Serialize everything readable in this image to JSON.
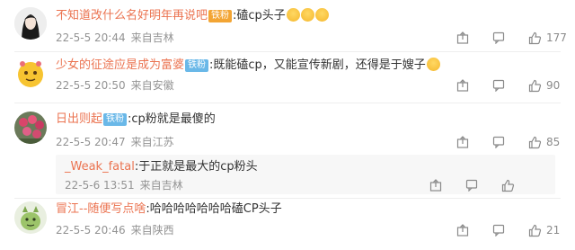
{
  "comments": [
    {
      "user": "不知道改什么名好明年再说吧",
      "badge": "铁粉",
      "colon": ":",
      "text": "磕cp头子",
      "time": "22-5-5 20:44",
      "location": "来自吉林",
      "likes": "177",
      "avatar": "girl-portrait"
    },
    {
      "user": "少女的征途应是成为富婆",
      "badge": "铁粉",
      "colon": ":",
      "text": "既能磕cp，又能宣传新剧，还得是于嫂子",
      "time": "22-5-5 20:50",
      "location": "来自安徽",
      "likes": "90",
      "avatar": "emoji-face"
    },
    {
      "user": "日出则起",
      "badge": "铁粉",
      "colon": ":",
      "text": "cp粉就是最傻的",
      "time": "22-5-5 20:47",
      "location": "来自江苏",
      "likes": "85",
      "avatar": "flowers",
      "reply": {
        "user": "_Weak_fatal",
        "colon": ":",
        "text": "于正就是最大的cp粉头",
        "time": "22-5-6 13:51",
        "location": "来自吉林"
      }
    },
    {
      "user": "冒江--随便写点啥",
      "colon": ":",
      "text": "哈哈哈哈哈哈哈磕CP头子",
      "time": "22-5-5 20:46",
      "location": "来自陕西",
      "likes": "21",
      "avatar": "green-character"
    }
  ],
  "colors": {
    "username": "#eb7350",
    "meta": "#939393",
    "badge": "#6ab8e8",
    "reply_bg": "#f7f7f7"
  }
}
